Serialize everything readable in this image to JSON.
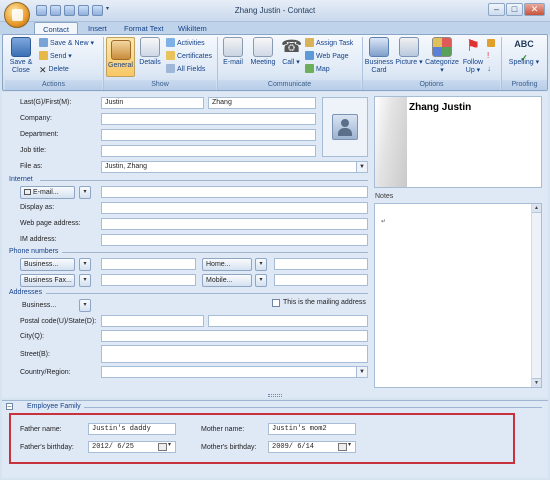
{
  "window": {
    "title": "Zhang Justin - Contact"
  },
  "tabs": [
    {
      "label": "Contact",
      "active": true
    },
    {
      "label": "Insert"
    },
    {
      "label": "Format Text"
    },
    {
      "label": "WikiItem"
    }
  ],
  "ribbon": {
    "actions": {
      "group_label": "Actions",
      "save_close": "Save & Close",
      "save_new": "Save & New",
      "send": "Send",
      "delete": "Delete"
    },
    "show": {
      "group_label": "Show",
      "general": "General",
      "details": "Details",
      "activities": "Activities",
      "certificates": "Certificates",
      "all_fields": "All Fields"
    },
    "communicate": {
      "group_label": "Communicate",
      "email": "E-mail",
      "meeting": "Meeting",
      "call": "Call",
      "assign_task": "Assign Task",
      "web_page": "Web Page",
      "map": "Map"
    },
    "options": {
      "group_label": "Options",
      "business_card": "Business Card",
      "picture": "Picture",
      "categorize": "Categorize",
      "follow_up": "Follow Up"
    },
    "proofing": {
      "group_label": "Proofing",
      "spelling": "Spelling"
    }
  },
  "form": {
    "name_label": "Last(G)/First(M):",
    "first_name": "Justin",
    "last_name": "Zhang",
    "company_label": "Company:",
    "department_label": "Department:",
    "job_title_label": "Job title:",
    "file_as_label": "File as:",
    "file_as_value": "Justin, Zhang",
    "internet_title": "Internet",
    "email_btn": "E-mail...",
    "display_as_label": "Display as:",
    "web_page_label": "Web page address:",
    "im_label": "IM address:",
    "phone_title": "Phone numbers",
    "business_phone": "Business...",
    "home_phone": "Home...",
    "business_fax": "Business Fax...",
    "mobile_phone": "Mobile...",
    "addresses_title": "Addresses",
    "business_addr": "Business...",
    "mailing_label": "This is the mailing address",
    "postal_label": "Postal code(U)/State(D):",
    "city_label": "City(Q):",
    "street_label": "Street(B):",
    "country_label": "Country/Region:",
    "notes_label": "Notes"
  },
  "business_card": {
    "name": "Zhang Justin"
  },
  "employee_family": {
    "title": "Employee Family",
    "father_name_label": "Father name:",
    "father_name": "Justin's daddy",
    "mother_name_label": "Mother name:",
    "mother_name": "Justin's mom2",
    "father_birthday_label": "Father's birthday:",
    "father_birthday": "2012/ 6/25",
    "mother_birthday_label": "Mother's birthday:",
    "mother_birthday": "2009/ 6/14"
  },
  "colors": {
    "accent": "#15428b",
    "highlight": "#c8323e",
    "background": "#dfe8f5"
  }
}
